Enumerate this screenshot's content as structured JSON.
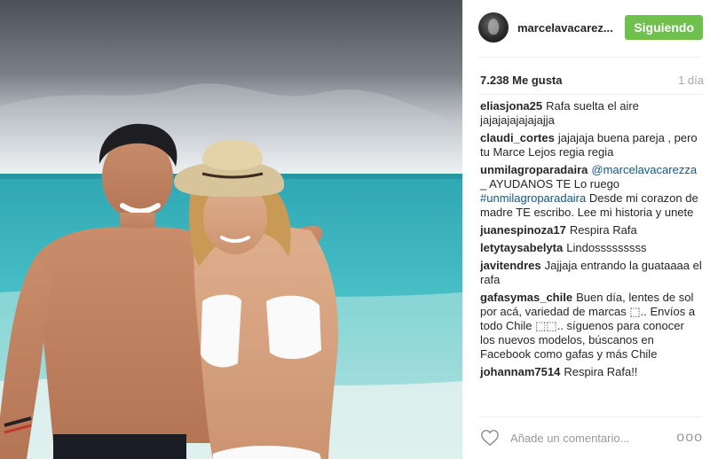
{
  "header": {
    "username": "marcelavacarez...",
    "follow_button": "Siguiendo"
  },
  "post": {
    "likes": "7.238 Me gusta",
    "time": "1 día"
  },
  "comments": [
    {
      "author": "eliasjona25",
      "text": "Rafa suelta el aire jajajajajajajajja"
    },
    {
      "author": "claudi_cortes",
      "text": "jajajaja buena pareja , pero tu Marce Lejos regia regia"
    },
    {
      "author": "unmilagroparadaira",
      "mention": "@marcelavacarezza",
      "text1": "_ AYUDANOS TE Lo ruego",
      "hashtag": "#unmilagroparadaira",
      "text2": "Desde mi corazon de madre TE escribo. Lee mi historia y unete"
    },
    {
      "author": "juanespinoza17",
      "text": "Respira Rafa"
    },
    {
      "author": "letytaysabelyta",
      "text": "Lindosssssssss"
    },
    {
      "author": "javitendres",
      "text": "Jajjaja entrando la guataaaa el rafa"
    },
    {
      "author": "gafasymas_chile",
      "text": "Buen día, lentes de sol por acá, variedad de marcas ⬚.. Envíos a todo Chile ⬚⬚.. síguenos para conocer los nuevos modelos, búscanos en Facebook como gafas y más Chile"
    },
    {
      "author": "johannam7514",
      "text": "Respira Rafa!!"
    }
  ],
  "footer": {
    "comment_placeholder": "Añade un comentario...",
    "more_label": "ooo"
  },
  "icons": {
    "heart": "heart-icon",
    "more": "more-options-icon"
  },
  "colors": {
    "follow_button": "#70c050",
    "link": "#125688",
    "muted": "#a5a7aa"
  }
}
